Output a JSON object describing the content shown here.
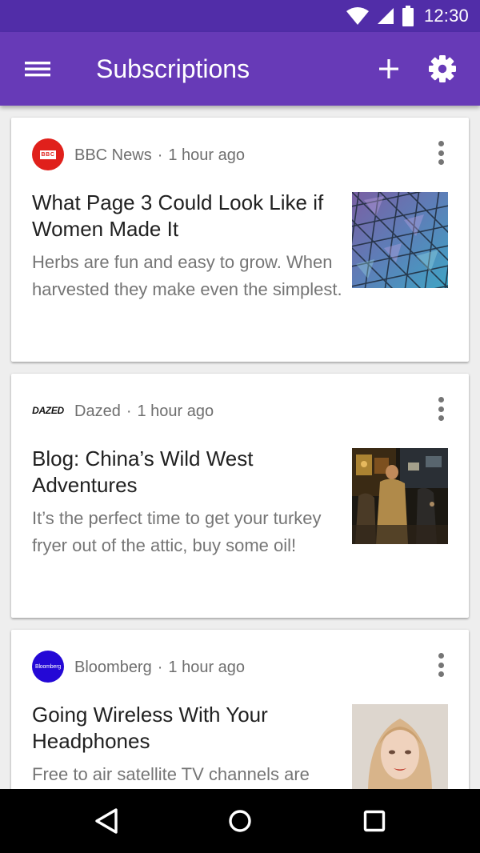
{
  "status_bar": {
    "time": "12:30",
    "icons": [
      "wifi-icon",
      "cellular-signal-icon",
      "battery-icon"
    ],
    "color": "#512da8"
  },
  "app_bar": {
    "title": "Subscriptions",
    "color": "#673ab7",
    "icons": [
      "hamburger-menu-icon",
      "add-icon",
      "settings-gear-icon"
    ]
  },
  "cards": [
    {
      "source": "BBC News",
      "logo_text": "BBC",
      "separator": "·",
      "time": "1 hour ago",
      "headline": "What Page 3 Could Look Like if Women Made It",
      "summary": "Herbs are fun and easy to grow. When harvested they make even the simplest.",
      "thumbnail": "geometric-glass-ceiling-photo"
    },
    {
      "source": "Dazed",
      "logo_text": "DAZED",
      "separator": "·",
      "time": "1 hour ago",
      "headline": "Blog: China’s Wild West Adventures",
      "summary": "It’s the perfect time to get your turkey fryer out of the attic, buy some oil!",
      "thumbnail": "night-market-street-photo"
    },
    {
      "source": "Bloomberg",
      "logo_text": "Bloomberg",
      "separator": "·",
      "time": "1 hour ago",
      "headline": "Going Wireless With Your Headphones",
      "summary": "Free to air satellite TV channels are",
      "thumbnail": "woman-portrait-photo"
    }
  ],
  "nav_bar": {
    "icons": [
      "back-icon",
      "home-icon",
      "recents-icon"
    ]
  }
}
